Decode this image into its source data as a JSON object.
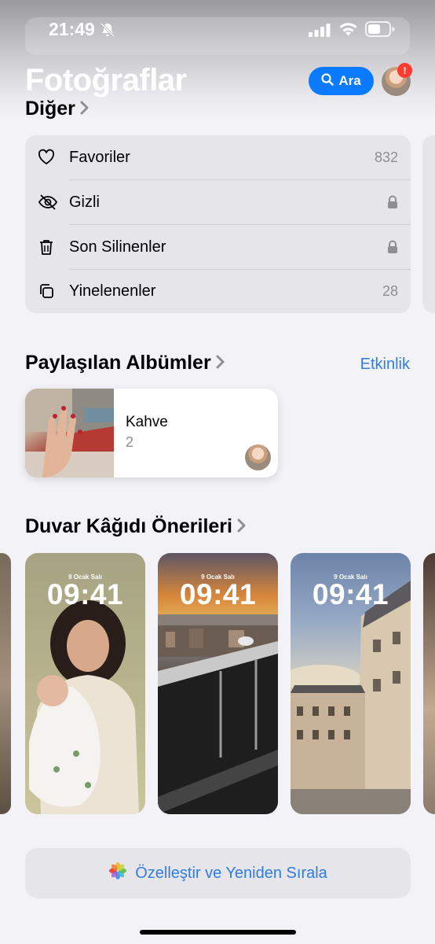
{
  "status_bar": {
    "time": "21:49"
  },
  "header": {
    "title": "Fotoğraflar",
    "search_label": "Ara",
    "notification_badge": "!"
  },
  "other_section": {
    "title": "Diğer",
    "items": [
      {
        "label": "Favoriler",
        "value": "832",
        "icon": "heart-icon"
      },
      {
        "label": "Gizli",
        "value": "",
        "icon": "eye-slash-icon",
        "locked": true
      },
      {
        "label": "Son Silinenler",
        "value": "",
        "icon": "trash-icon",
        "locked": true
      },
      {
        "label": "Yinelenenler",
        "value": "28",
        "icon": "duplicate-icon"
      }
    ]
  },
  "shared_albums": {
    "title": "Paylaşılan Albümler",
    "activity_label": "Etkinlik",
    "albums": [
      {
        "name": "Kahve",
        "count": "2"
      }
    ]
  },
  "wallpapers": {
    "title": "Duvar Kâğıdı Önerileri",
    "items": [
      {
        "date": "9 Ocak Salı",
        "time": "09:41"
      },
      {
        "date": "9 Ocak Salı",
        "time": "09:41"
      },
      {
        "date": "9 Ocak Salı",
        "time": "09:41"
      }
    ]
  },
  "customize": {
    "label": "Özelleştir ve Yeniden Sırala"
  },
  "colors": {
    "accent": "#0a7aff",
    "link": "#2f7de1",
    "badge": "#ff3b30"
  }
}
